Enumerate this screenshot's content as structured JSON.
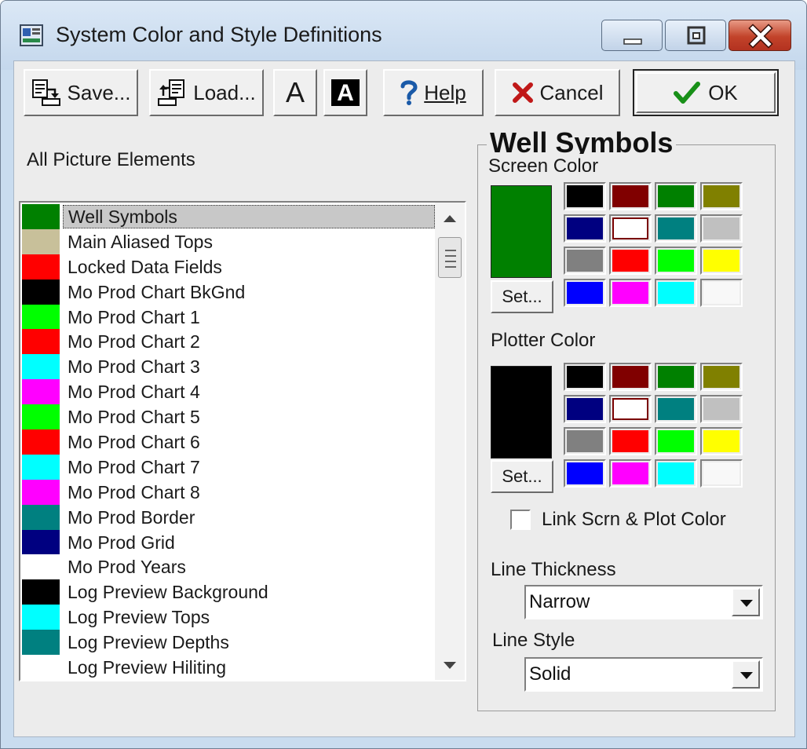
{
  "window": {
    "title": "System Color and Style Definitions"
  },
  "toolbar": {
    "save_label": "Save...",
    "load_label": "Load...",
    "font_a_label": "A",
    "font_b_label": "A",
    "help_label": "Help",
    "cancel_label": "Cancel",
    "ok_label": "OK"
  },
  "list": {
    "label": "All Picture Elements",
    "items": [
      {
        "label": "Well Symbols",
        "color": "#008000"
      },
      {
        "label": "Main Aliased Tops",
        "color": "#c8c09a"
      },
      {
        "label": "Locked Data Fields",
        "color": "#ff0000"
      },
      {
        "label": "Mo Prod Chart BkGnd",
        "color": "#000000"
      },
      {
        "label": "Mo Prod Chart 1",
        "color": "#00ff00"
      },
      {
        "label": "Mo Prod Chart 2",
        "color": "#ff0000"
      },
      {
        "label": "Mo Prod Chart 3",
        "color": "#00ffff"
      },
      {
        "label": "Mo Prod Chart 4",
        "color": "#ff00ff"
      },
      {
        "label": "Mo Prod Chart 5",
        "color": "#00ff00"
      },
      {
        "label": "Mo Prod Chart 6",
        "color": "#ff0000"
      },
      {
        "label": "Mo Prod Chart 7",
        "color": "#00ffff"
      },
      {
        "label": "Mo Prod Chart 8",
        "color": "#ff00ff"
      },
      {
        "label": "Mo Prod Border",
        "color": "#008080"
      },
      {
        "label": "Mo Prod Grid",
        "color": "#000080"
      },
      {
        "label": "Mo Prod Years",
        "color": "#ffffff"
      },
      {
        "label": "Log Preview Background",
        "color": "#000000"
      },
      {
        "label": "Log Preview Tops",
        "color": "#00ffff"
      },
      {
        "label": "Log Preview Depths",
        "color": "#008080"
      },
      {
        "label": "Log Preview Hiliting",
        "color": "#ffffff"
      }
    ]
  },
  "panel": {
    "title": "Well Symbols",
    "screen_color_label": "Screen Color",
    "screen_color": "#008000",
    "plotter_color_label": "Plotter Color",
    "plotter_color": "#000000",
    "set_label": "Set...",
    "palette": [
      "#000000",
      "#800000",
      "#008000",
      "#808000",
      "#000080",
      "#ffffff",
      "#008080",
      "#c0c0c0",
      "#808080",
      "#ff0000",
      "#00ff00",
      "#ffff00",
      "#0000ff",
      "#ff00ff",
      "#00ffff",
      "#f8f8f8"
    ],
    "link_label": "Link Scrn & Plot Color",
    "link_checked": false,
    "line_thickness_label": "Line Thickness",
    "line_thickness_value": "Narrow",
    "line_style_label": "Line Style",
    "line_style_value": "Solid"
  }
}
